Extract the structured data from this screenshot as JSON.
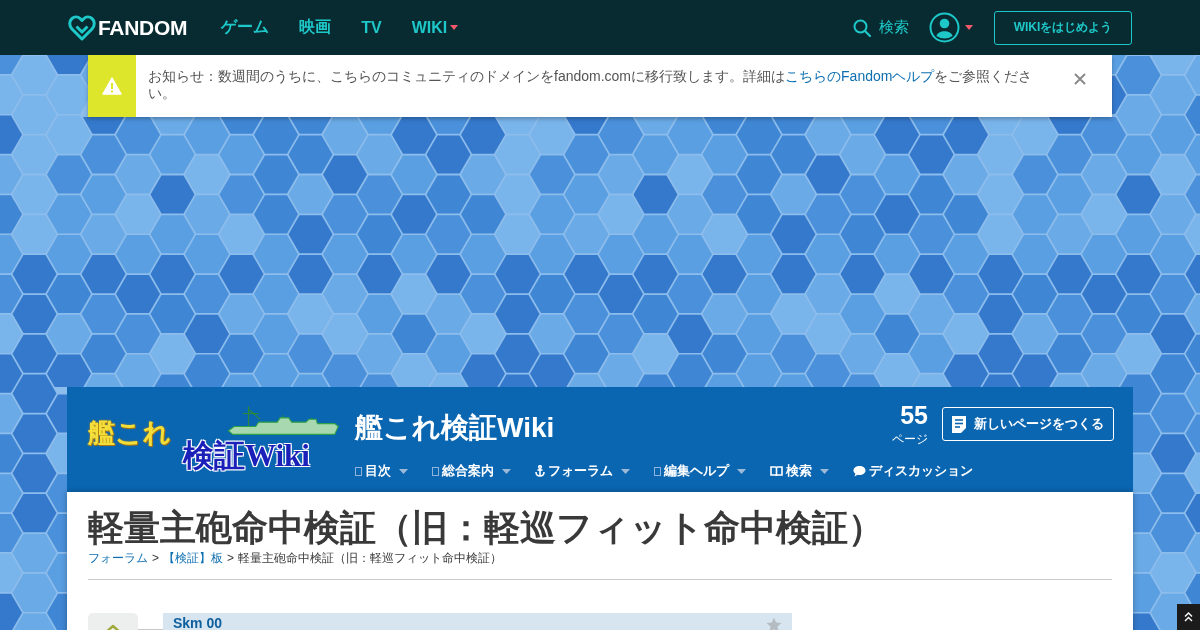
{
  "top_bar": {
    "brand": "FANDOM",
    "nav": [
      {
        "label": "ゲーム",
        "has_menu": false
      },
      {
        "label": "映画",
        "has_menu": false
      },
      {
        "label": "TV",
        "has_menu": false
      },
      {
        "label": "WIKI",
        "has_menu": true
      }
    ],
    "search_label": "検索",
    "start_button": "WIKIをはじめよう"
  },
  "notice": {
    "text_before": "お知らせ：数週間のうちに、こちらのコミュニティのドメインをfandom.comに移行致します。詳細は",
    "link": "こちらのFandomヘルプ",
    "text_after": "をご参照ください。"
  },
  "wiki_header": {
    "logo": {
      "line_1": "艦これ",
      "line_2": "検証Wiki"
    },
    "title": "艦これ検証Wiki",
    "page_count": "55",
    "page_count_label": "ページ",
    "new_page_button": "新しいページをつくる",
    "nav": [
      {
        "label": "目次",
        "kind": "square",
        "has_menu": true
      },
      {
        "label": "総合案内",
        "kind": "square",
        "has_menu": true
      },
      {
        "label": "フォーラム",
        "kind": "anchor",
        "has_menu": true
      },
      {
        "label": "編集ヘルプ",
        "kind": "square",
        "has_menu": true
      },
      {
        "label": "検索",
        "kind": "book",
        "has_menu": true
      },
      {
        "label": "ディスカッション",
        "kind": "speech",
        "has_menu": false
      }
    ]
  },
  "page": {
    "title": "軽量主砲命中検証（旧：軽巡フィット命中検証）",
    "breadcrumb": [
      {
        "label": "フォーラム",
        "link": true
      },
      {
        "separator_before": ">",
        "label": "【検証】板",
        "link": true
      },
      {
        "separator_before": ">",
        "label": "軽量主砲命中検証（旧：軽巡フィット命中検証）",
        "link": false
      }
    ]
  },
  "thread": {
    "posts": [
      {
        "author": "Skm 00"
      }
    ]
  }
}
